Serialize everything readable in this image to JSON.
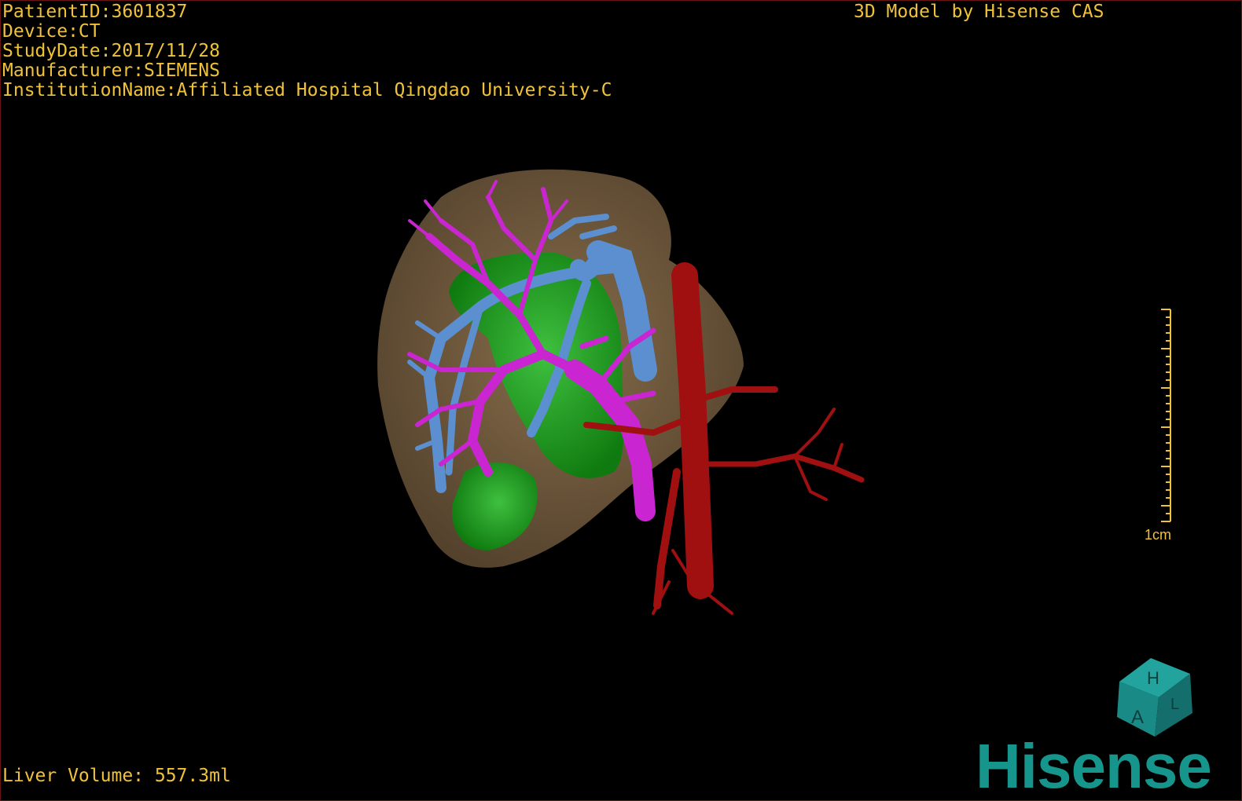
{
  "overlay": {
    "patient_id": "PatientID:3601837",
    "device": "Device:CT",
    "study_date": "StudyDate:2017/11/28",
    "manufacturer": "Manufacturer:SIEMENS",
    "institution": "InstitutionName:Affiliated Hospital Qingdao University-C",
    "credit": "3D Model by Hisense CAS",
    "liver_volume": "Liver Volume: 557.3ml"
  },
  "scale_bar": {
    "label": "1cm"
  },
  "orientation_cube": {
    "faces": [
      "H",
      "A",
      "L"
    ],
    "color": "#1a8a86"
  },
  "logo": {
    "text": "Hisense",
    "color": "#16958d"
  },
  "colors": {
    "text": "#f0c23a",
    "liver": "#8a6e4b",
    "lesion": "#1fa01f",
    "portal_vein": "#c925d0",
    "hepatic_vein": "#5b8fd0",
    "artery": "#a01010"
  },
  "icons": [
    "orientation-cube-icon",
    "hisense-logo"
  ]
}
